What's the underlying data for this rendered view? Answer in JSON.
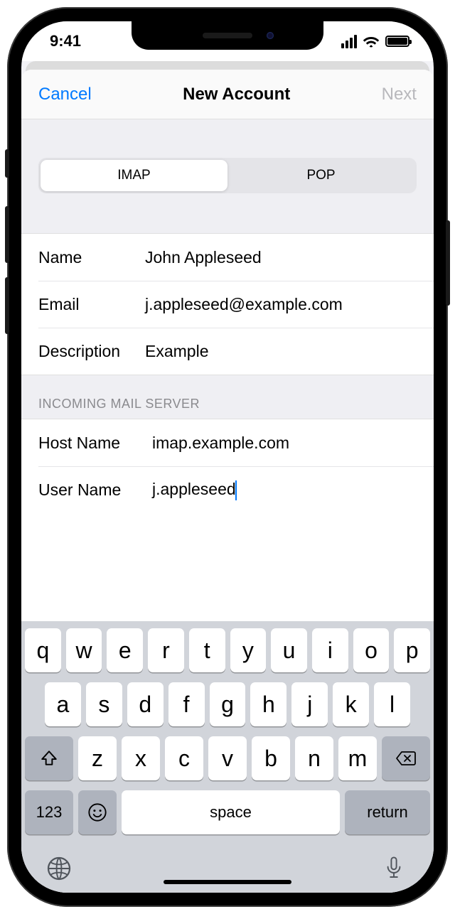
{
  "status": {
    "time": "9:41"
  },
  "nav": {
    "cancel": "Cancel",
    "title": "New Account",
    "next": "Next"
  },
  "segments": {
    "imap": "IMAP",
    "pop": "POP"
  },
  "fields": {
    "name_label": "Name",
    "name_value": "John Appleseed",
    "email_label": "Email",
    "email_value": "j.appleseed@example.com",
    "description_label": "Description",
    "description_value": "Example"
  },
  "incoming": {
    "header": "Incoming Mail Server",
    "hostname_label": "Host Name",
    "hostname_value": "imap.example.com",
    "username_label": "User Name",
    "username_value": "j.appleseed"
  },
  "keyboard": {
    "row1": [
      "q",
      "w",
      "e",
      "r",
      "t",
      "y",
      "u",
      "i",
      "o",
      "p"
    ],
    "row2": [
      "a",
      "s",
      "d",
      "f",
      "g",
      "h",
      "j",
      "k",
      "l"
    ],
    "row3": [
      "z",
      "x",
      "c",
      "v",
      "b",
      "n",
      "m"
    ],
    "numbers": "123",
    "space": "space",
    "return": "return"
  }
}
